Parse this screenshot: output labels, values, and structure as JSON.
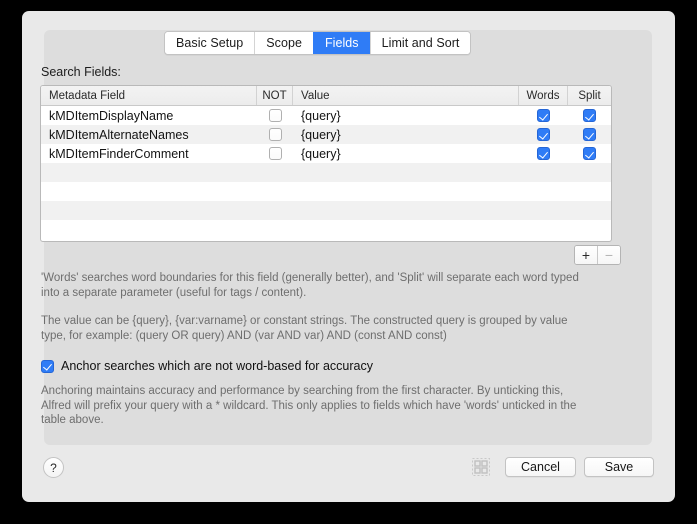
{
  "tabs": [
    {
      "label": "Basic Setup",
      "selected": false
    },
    {
      "label": "Scope",
      "selected": false
    },
    {
      "label": "Fields",
      "selected": true
    },
    {
      "label": "Limit and Sort",
      "selected": false
    }
  ],
  "section": {
    "search_fields_label": "Search Fields:"
  },
  "table": {
    "columns": [
      "Metadata Field",
      "NOT",
      "Value",
      "Words",
      "Split"
    ],
    "rows": [
      {
        "field": "kMDItemDisplayName",
        "not": false,
        "value": "{query}",
        "words": true,
        "split": true
      },
      {
        "field": "kMDItemAlternateNames",
        "not": false,
        "value": "{query}",
        "words": true,
        "split": true
      },
      {
        "field": "kMDItemFinderComment",
        "not": false,
        "value": "{query}",
        "words": true,
        "split": true
      }
    ],
    "empty_row_count": 4
  },
  "row_controls": {
    "add_label": "+",
    "remove_label": "−",
    "add_enabled": true,
    "remove_enabled": false
  },
  "help": {
    "words_split": "'Words' searches word boundaries for this field (generally better), and 'Split' will separate each word typed into a separate parameter (useful for tags / content).",
    "value_types": "The value can be {query}, {var:varname} or constant strings. The constructed query is grouped by value type, for example: (query OR query) AND (var AND var) AND (const AND const)",
    "anchoring": "Anchoring maintains accuracy and performance by searching from the first character. By unticking this, Alfred will prefix your query with a * wildcard. This only applies to fields which have 'words' unticked in the table above."
  },
  "anchor_option": {
    "label": "Anchor searches which are not word-based for accuracy",
    "checked": true
  },
  "footer": {
    "help_label": "?",
    "grid_icon": "grid-icon",
    "cancel_label": "Cancel",
    "save_label": "Save"
  },
  "colors": {
    "accent_blue": "#2f7cf6",
    "window_bg": "#e9e9e9",
    "panel_bg": "#dddddd",
    "table_row_alt": "#f1f1f1"
  }
}
